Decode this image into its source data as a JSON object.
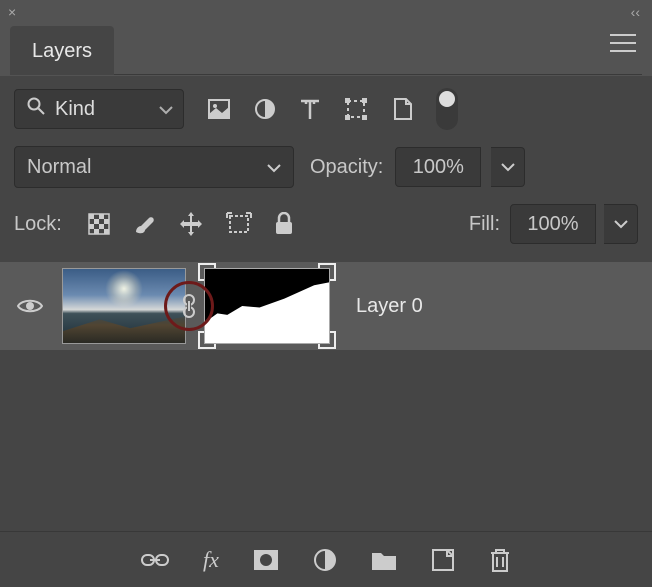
{
  "panel": {
    "close_glyph": "×",
    "collapse_glyph": "‹‹",
    "tab_label": "Layers"
  },
  "filter": {
    "kind_label": "Kind"
  },
  "blend": {
    "mode": "Normal",
    "opacity_label": "Opacity:",
    "opacity_value": "100%"
  },
  "lock": {
    "label": "Lock:",
    "fill_label": "Fill:",
    "fill_value": "100%"
  },
  "layers": [
    {
      "name": "Layer 0",
      "visible": true,
      "linked": true
    }
  ],
  "bottom": {
    "fx_label": "fx"
  }
}
